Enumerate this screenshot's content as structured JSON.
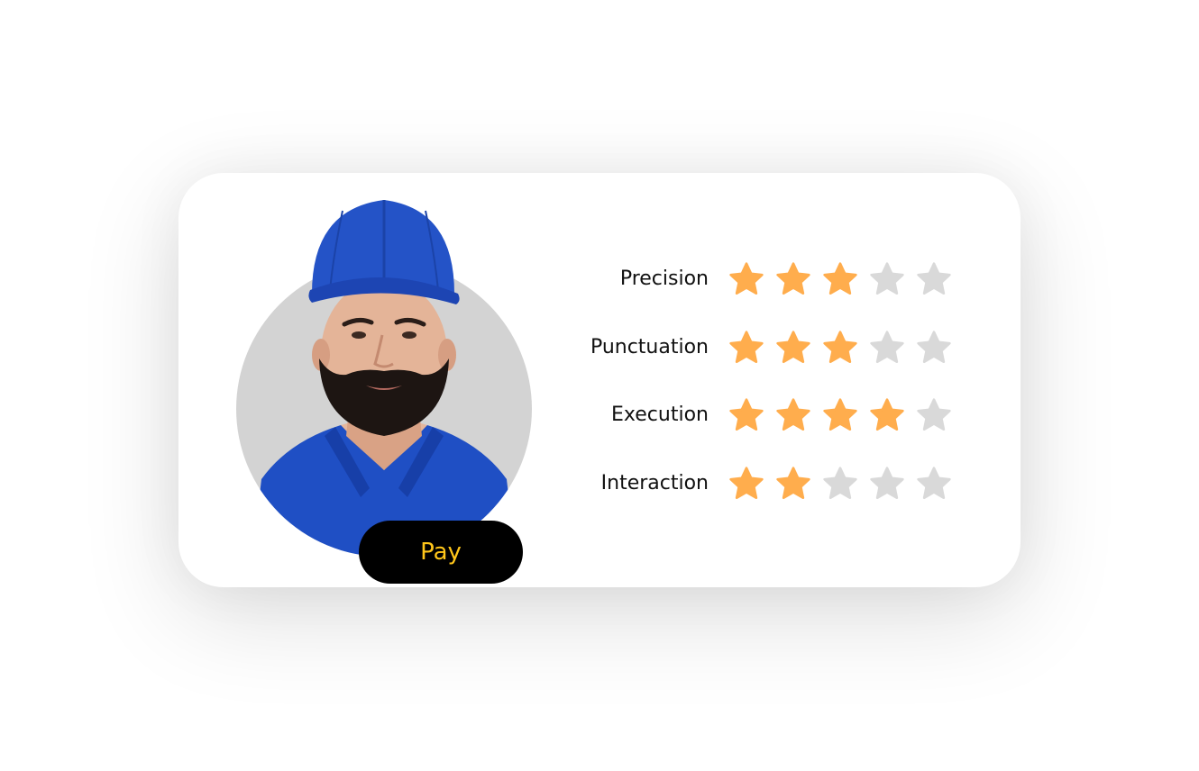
{
  "card": {
    "pay_label": "Pay",
    "pay_label_color": "#ffc61a",
    "pay_bg_color": "#000000"
  },
  "avatar": {
    "icon": "worker-avatar",
    "bg_color": "#d3d3d3"
  },
  "star_colors": {
    "filled": "#ffad4d",
    "empty": "#d9d9d9"
  },
  "ratings": [
    {
      "label": "Precision",
      "value": 3,
      "max": 5
    },
    {
      "label": "Punctuation",
      "value": 3,
      "max": 5
    },
    {
      "label": "Execution",
      "value": 4,
      "max": 5
    },
    {
      "label": "Interaction",
      "value": 2,
      "max": 5
    }
  ]
}
